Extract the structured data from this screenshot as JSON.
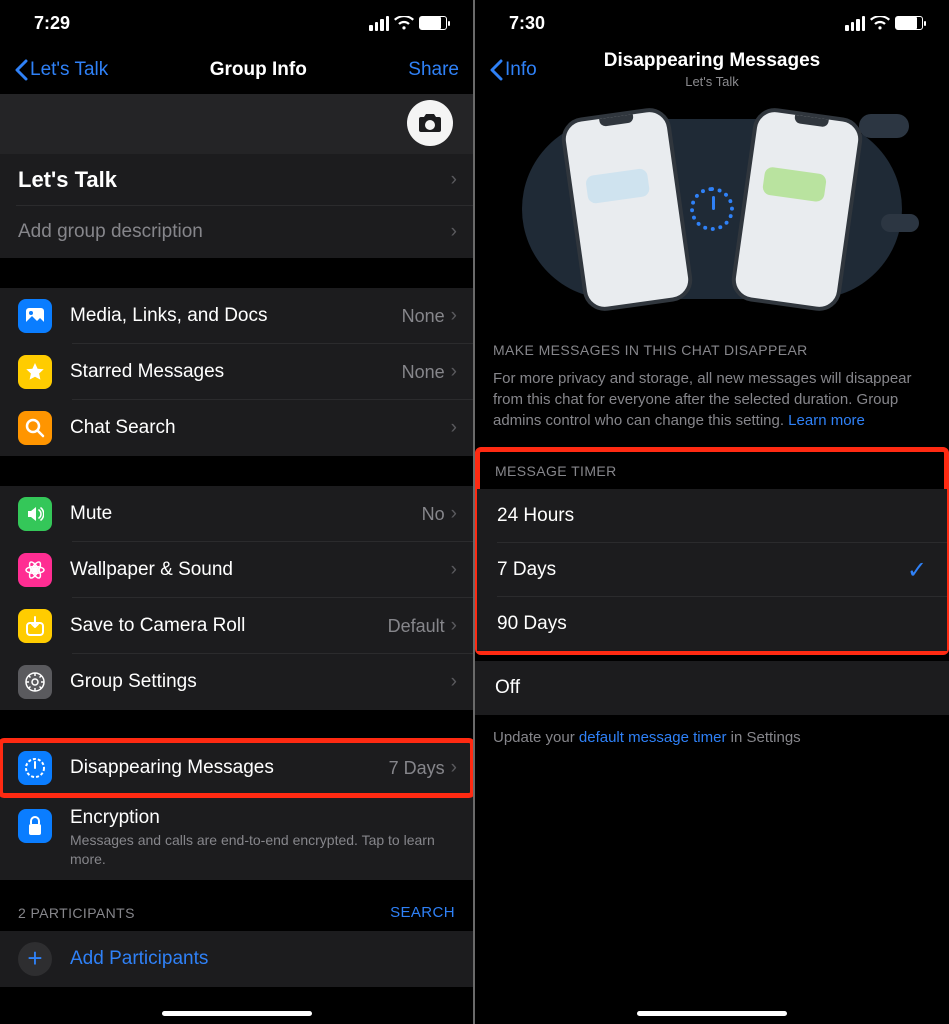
{
  "left": {
    "status_time": "7:29",
    "nav_back": "Let's Talk",
    "nav_title": "Group Info",
    "nav_action": "Share",
    "group_name": "Let's Talk",
    "group_desc_placeholder": "Add group description",
    "items1": [
      {
        "label": "Media, Links, and Docs",
        "val": "None",
        "icon": "photo",
        "color": "#0a7dff"
      },
      {
        "label": "Starred Messages",
        "val": "None",
        "icon": "star",
        "color": "#ffcc00"
      },
      {
        "label": "Chat Search",
        "val": "",
        "icon": "search",
        "color": "#ff9500"
      }
    ],
    "items2": [
      {
        "label": "Mute",
        "val": "No",
        "icon": "speaker",
        "color": "#34c759"
      },
      {
        "label": "Wallpaper & Sound",
        "val": "",
        "icon": "flower",
        "color": "#ff2d92"
      },
      {
        "label": "Save to Camera Roll",
        "val": "Default",
        "icon": "save",
        "color": "#ffcc00"
      },
      {
        "label": "Group Settings",
        "val": "",
        "icon": "gear",
        "color": "#5a5a5e"
      }
    ],
    "disappearing": {
      "label": "Disappearing Messages",
      "val": "7 Days"
    },
    "encryption": {
      "label": "Encryption",
      "desc": "Messages and calls are end-to-end encrypted. Tap to learn more."
    },
    "participants_header": "2 PARTICIPANTS",
    "participants_action": "SEARCH",
    "add_participants": "Add Participants"
  },
  "right": {
    "status_time": "7:30",
    "nav_back": "Info",
    "nav_title": "Disappearing Messages",
    "nav_subtitle": "Let's Talk",
    "section1_header": "MAKE MESSAGES IN THIS CHAT DISAPPEAR",
    "section1_body": "For more privacy and storage, all new messages will disappear from this chat for everyone after the selected duration. Group admins control who can change this setting. ",
    "learn_more": "Learn more",
    "timer_header": "MESSAGE TIMER",
    "options": [
      {
        "label": "24 Hours",
        "selected": false
      },
      {
        "label": "7 Days",
        "selected": true
      },
      {
        "label": "90 Days",
        "selected": false
      }
    ],
    "off_label": "Off",
    "footer_pre": "Update your ",
    "footer_link": "default message timer",
    "footer_post": " in Settings"
  }
}
